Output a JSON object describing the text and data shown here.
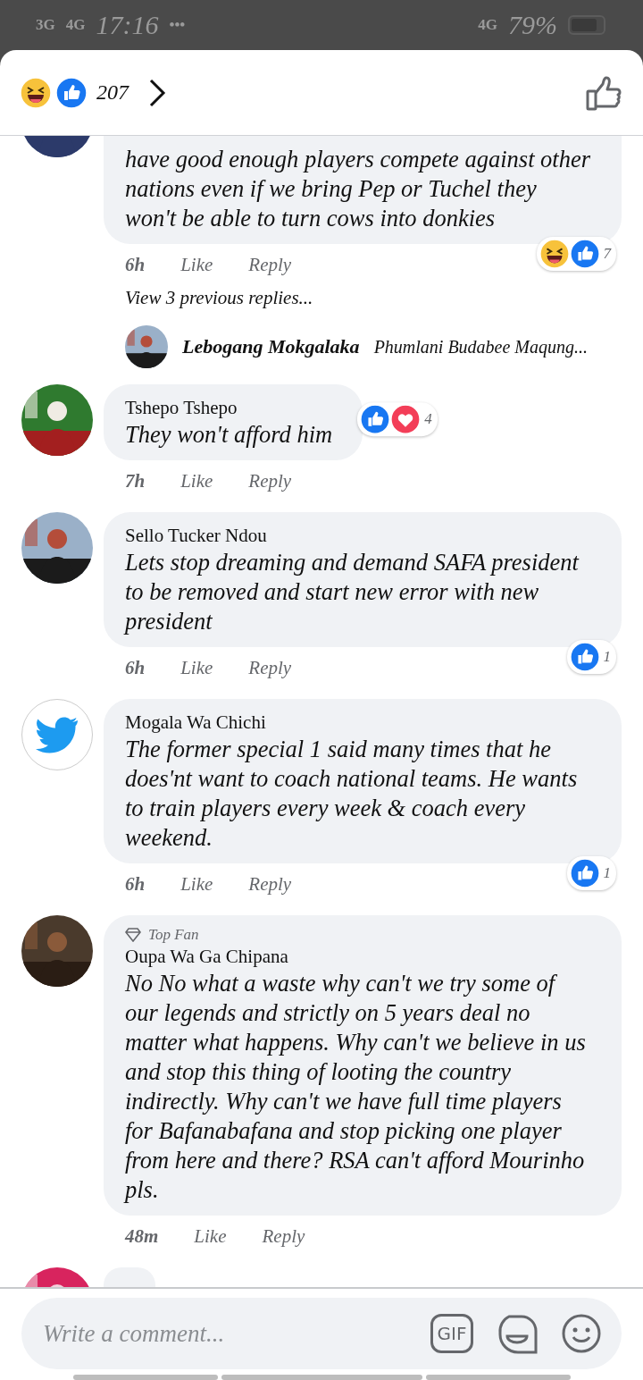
{
  "status_bar": {
    "left": [
      "3G",
      "4G"
    ],
    "time": "17:16",
    "more": "•••",
    "network": "4G",
    "battery_text": "79%"
  },
  "header": {
    "reactions": [
      {
        "kind": "laugh"
      },
      {
        "kind": "like"
      }
    ],
    "count": "207"
  },
  "comments": [
    {
      "avatar": {
        "kind": "picture"
      },
      "body": "have good enough players compete against other nations even if we bring Pep or Tuchel they won't be able to turn cows into donkies",
      "time": "6h",
      "like": "Like",
      "reply": "Reply",
      "reactions": [
        {
          "kind": "laugh"
        },
        {
          "kind": "like"
        }
      ],
      "reaction_count": "7",
      "view_replies": "View 3 previous replies...",
      "reply_preview": {
        "avatar": {
          "kind": "picture"
        },
        "name": "Lebogang Mokgalaka",
        "text": "Phumlani Budabee Maqung..."
      }
    },
    {
      "avatar": {
        "kind": "picture"
      },
      "name": "Tshepo Tshepo",
      "body": "They won't afford him",
      "time": "7h",
      "like": "Like",
      "reply": "Reply",
      "reactions": [
        {
          "kind": "like"
        },
        {
          "kind": "love"
        }
      ],
      "reaction_count": "4"
    },
    {
      "avatar": {
        "kind": "picture"
      },
      "name": "Sello Tucker Ndou",
      "body": "Lets stop dreaming and demand SAFA president to be removed and start new error with new president",
      "time": "6h",
      "like": "Like",
      "reply": "Reply",
      "reactions": [
        {
          "kind": "like"
        }
      ],
      "reaction_count": "1"
    },
    {
      "avatar": {
        "kind": "bird"
      },
      "name": "Mogala Wa Chichi",
      "body": "The former special 1 said many times that he does'nt want to coach national teams. He wants to train players every week & coach every weekend.",
      "time": "6h",
      "like": "Like",
      "reply": "Reply",
      "reactions": [
        {
          "kind": "like"
        }
      ],
      "reaction_count": "1"
    },
    {
      "avatar": {
        "kind": "picture"
      },
      "name": "Oupa Wa Ga Chipana",
      "badge": "Top Fan",
      "body": "No No what a waste why can't we try some of our legends and strictly on 5 years deal no matter what happens. Why can't we believe in us and stop this thing of looting the country indirectly. Why can't we have full time players for Bafanabafana and stop picking one player from here and there? RSA can't afford Mourinho pls.",
      "time": "48m",
      "like": "Like",
      "reply": "Reply"
    },
    {
      "avatar": {
        "kind": "picture"
      }
    }
  ],
  "composer": {
    "placeholder": "Write a comment...",
    "gif_label": "GIF"
  }
}
